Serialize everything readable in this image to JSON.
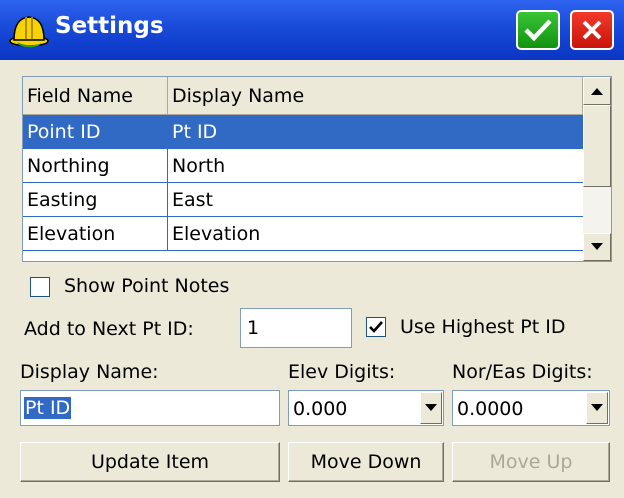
{
  "titlebar": {
    "title": "Settings",
    "app_icon": "hardhat-icon",
    "ok_icon": "checkmark-icon",
    "cancel_icon": "close-icon",
    "colors": {
      "bar": "#1748d6",
      "ok": "#19a316",
      "cancel": "#e1261a"
    }
  },
  "grid": {
    "columns": [
      "Field Name",
      "Display Name"
    ],
    "rows": [
      {
        "field": "Point ID",
        "display": "Pt ID",
        "selected": true
      },
      {
        "field": "Northing",
        "display": "North",
        "selected": false
      },
      {
        "field": "Easting",
        "display": "East",
        "selected": false
      },
      {
        "field": "Elevation",
        "display": "Elevation",
        "selected": false
      }
    ],
    "selection_color": "#316ac5"
  },
  "show_point_notes": {
    "label": "Show Point Notes",
    "checked": false
  },
  "next_pt_id": {
    "label": "Add to Next Pt ID:",
    "value": "1"
  },
  "use_highest": {
    "label": "Use Highest Pt ID",
    "checked": true
  },
  "display_name": {
    "label": "Display Name:",
    "value": "Pt ID"
  },
  "elev_digits": {
    "label": "Elev Digits:",
    "value": "0.000"
  },
  "nor_eas_digits": {
    "label": "Nor/Eas Digits:",
    "value": "0.0000"
  },
  "buttons": {
    "update": "Update Item",
    "move_down": "Move Down",
    "move_up": "Move Up"
  }
}
